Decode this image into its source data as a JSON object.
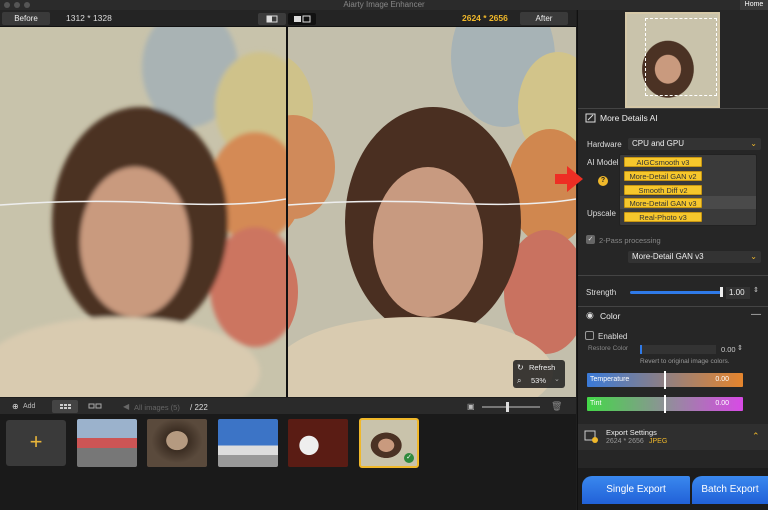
{
  "app": {
    "title": "Aiarty Image Enhancer",
    "home": "Home"
  },
  "compare": {
    "before": "Before",
    "before_res": "1312 * 1328",
    "after": "After",
    "after_res": "2624 * 2656"
  },
  "zoom": {
    "refresh": "Refresh",
    "level": "53%"
  },
  "bottom": {
    "add": "Add",
    "all_images": "All images (5)",
    "count": "/ 222"
  },
  "panel": {
    "section": "More Details AI",
    "hardware_label": "Hardware",
    "hardware_value": "CPU and GPU",
    "ai_model_label": "AI Model",
    "dropdown": [
      "AIGCsmooth  v3",
      "More-Detail GAN  v2",
      "Smooth Diff  v2",
      "More-Detail GAN  v3",
      "Real-Photo  v3"
    ],
    "upscale_label": "Upscale",
    "twopass_label": "2-Pass processing",
    "twopass_value": "More-Detail GAN  v3",
    "strength_label": "Strength",
    "strength_value": "1.00",
    "color_title": "Color",
    "enabled_label": "Enabled",
    "restore_label": "Restore Color",
    "restore_value": "0.00",
    "restore_hint": "Revert to original image colors.",
    "temperature_label": "Temperature",
    "temperature_value": "0.00",
    "tint_label": "Tint",
    "tint_value": "0.00",
    "export_title": "Export Settings",
    "export_detail": "2624 * 2656",
    "export_format": "JPEG",
    "single_export": "Single Export",
    "batch_export": "Batch Export"
  },
  "colors": {
    "accent": "#f0b82a",
    "blue": "#2f7ae8"
  }
}
